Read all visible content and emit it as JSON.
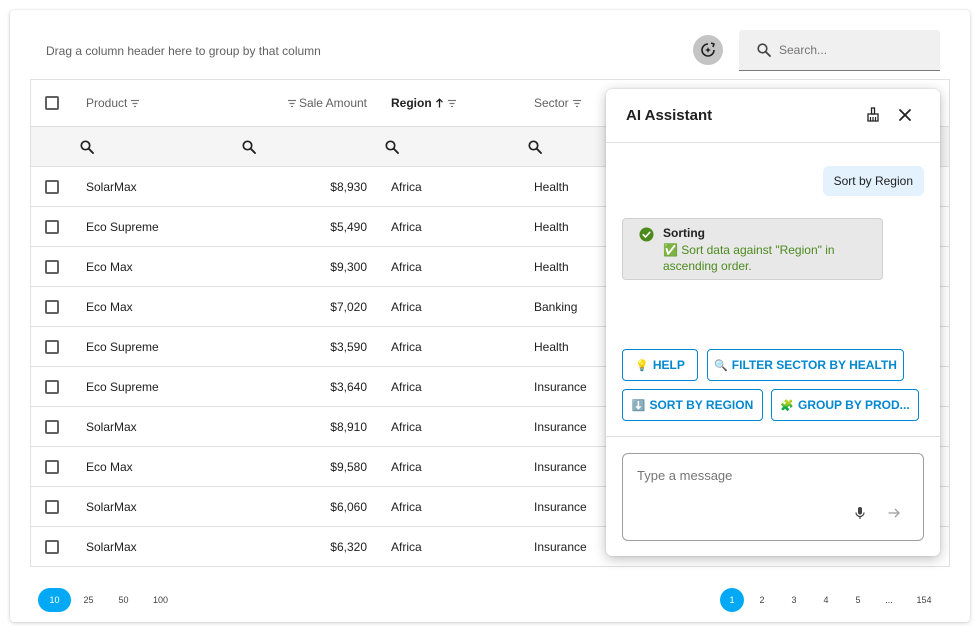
{
  "toolbar": {
    "group_hint": "Drag a column header here to group by that column",
    "search_placeholder": "Search...",
    "ai_toggle_icon": "ai-assist-icon"
  },
  "grid": {
    "columns": [
      {
        "label": "Product",
        "filter_icon": "filter-icon"
      },
      {
        "label": "Sale Amount",
        "filter_icon": "filter-icon"
      },
      {
        "label": "Region",
        "sorted": "ascending",
        "sort_icon": "arrow-up-icon",
        "filter_icon": "filter-icon"
      },
      {
        "label": "Sector",
        "filter_icon": "filter-icon"
      }
    ],
    "rows": [
      {
        "product": "SolarMax",
        "amount": "$8,930",
        "region": "Africa",
        "sector": "Health"
      },
      {
        "product": "Eco Supreme",
        "amount": "$5,490",
        "region": "Africa",
        "sector": "Health"
      },
      {
        "product": "Eco Max",
        "amount": "$9,300",
        "region": "Africa",
        "sector": "Health"
      },
      {
        "product": "Eco Max",
        "amount": "$7,020",
        "region": "Africa",
        "sector": "Banking"
      },
      {
        "product": "Eco Supreme",
        "amount": "$3,590",
        "region": "Africa",
        "sector": "Health"
      },
      {
        "product": "Eco Supreme",
        "amount": "$3,640",
        "region": "Africa",
        "sector": "Insurance"
      },
      {
        "product": "SolarMax",
        "amount": "$8,910",
        "region": "Africa",
        "sector": "Insurance"
      },
      {
        "product": "Eco Max",
        "amount": "$9,580",
        "region": "Africa",
        "sector": "Insurance"
      },
      {
        "product": "SolarMax",
        "amount": "$6,060",
        "region": "Africa",
        "sector": "Insurance"
      },
      {
        "product": "SolarMax",
        "amount": "$6,320",
        "region": "Africa",
        "sector": "Insurance"
      }
    ]
  },
  "pager": {
    "page_sizes": [
      "10",
      "25",
      "50",
      "100"
    ],
    "selected_page_size": "10",
    "pages": [
      "1",
      "2",
      "3",
      "4",
      "5",
      "...",
      "154"
    ],
    "current_page": "1"
  },
  "ai_panel": {
    "title": "AI Assistant",
    "user_message": "Sort by Region",
    "response": {
      "title": "Sorting",
      "line1": "✅ Sort data against \"Region\" in",
      "line2": "ascending order."
    },
    "suggestions": [
      {
        "emoji": "💡",
        "label": "HELP"
      },
      {
        "emoji": "🔍",
        "label": "FILTER SECTOR BY HEALTH"
      },
      {
        "emoji": "⬇️",
        "label": "SORT BY REGION"
      },
      {
        "emoji": "🧩",
        "label": "GROUP BY PROD..."
      }
    ],
    "input_placeholder": "Type a message"
  },
  "colors": {
    "accent": "#03a9f4",
    "chip_border": "#0288d1",
    "success": "#4c8a1e",
    "user_bubble": "#e3f2fd"
  }
}
